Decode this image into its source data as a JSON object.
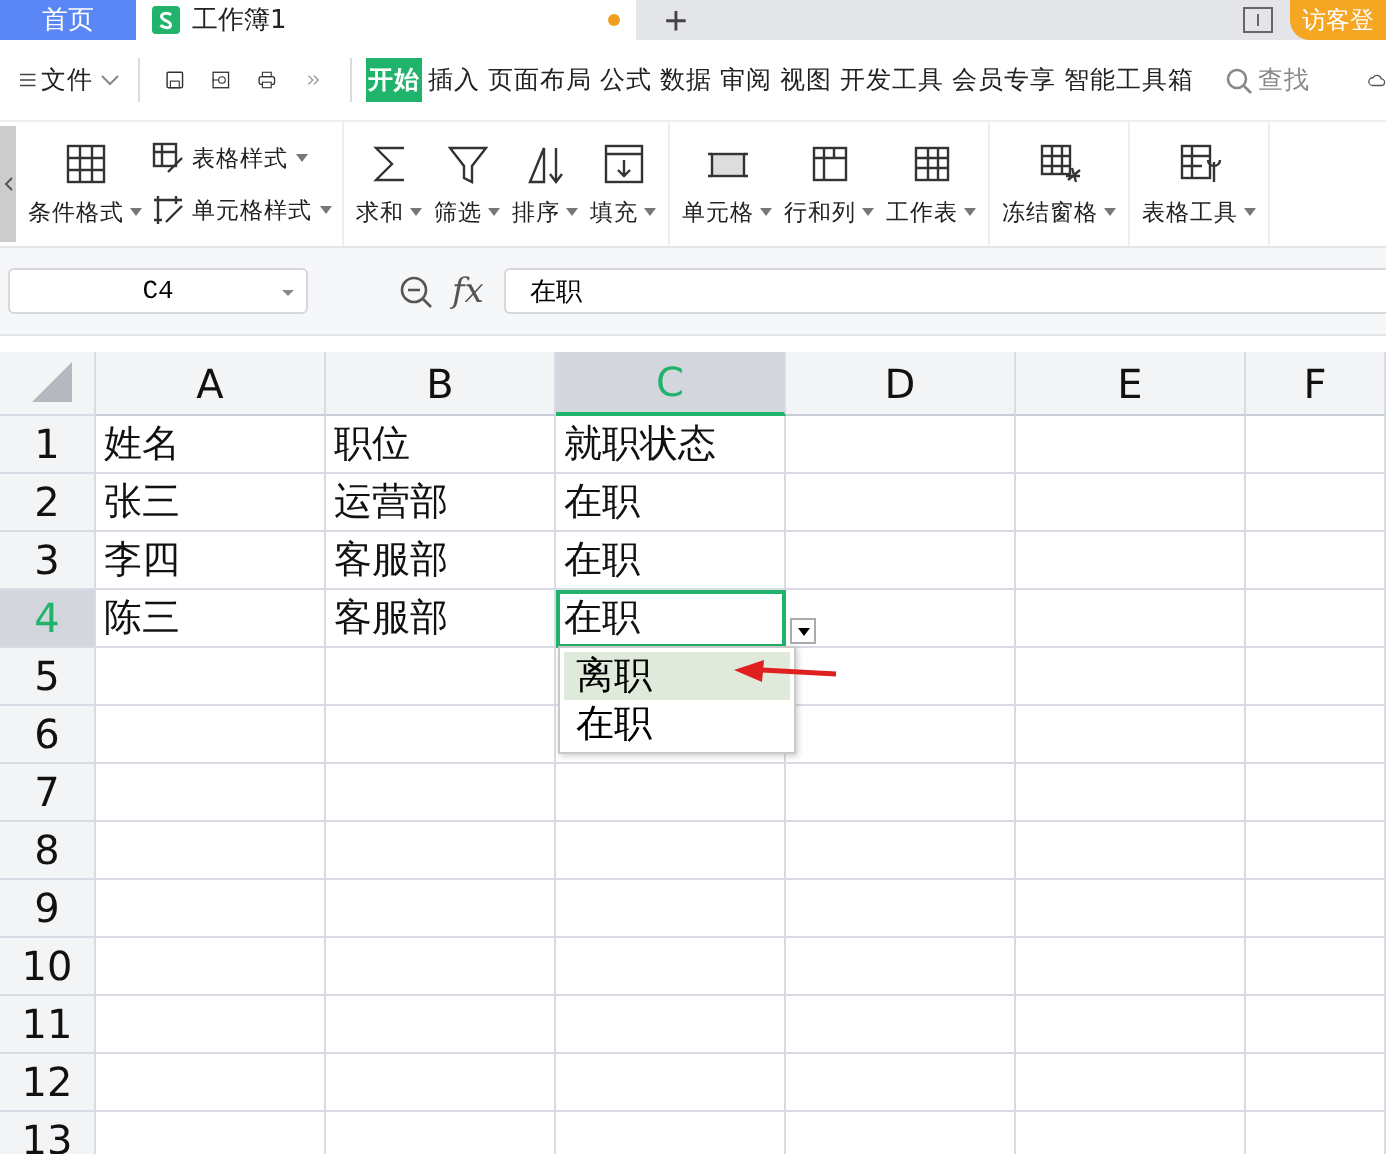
{
  "tabs": [
    {
      "label": "首页",
      "selected": false,
      "modified": false
    },
    {
      "label": "工作簿1",
      "selected": true,
      "modified": true
    }
  ],
  "new_tab": "+",
  "account_button": "访客登",
  "menu": {
    "file": "文件",
    "search": "查找",
    "items": [
      {
        "label": "开始",
        "selected": true
      },
      {
        "label": "插入",
        "selected": false
      },
      {
        "label": "页面布局",
        "selected": false
      },
      {
        "label": "公式",
        "selected": false
      },
      {
        "label": "数据",
        "selected": false
      },
      {
        "label": "审阅",
        "selected": false
      },
      {
        "label": "视图",
        "selected": false
      },
      {
        "label": "开发工具",
        "selected": false
      },
      {
        "label": "会员专享",
        "selected": false
      },
      {
        "label": "智能工具箱",
        "selected": false
      }
    ]
  },
  "ribbon": [
    [
      {
        "kind": "large",
        "label": "条件格式"
      },
      {
        "kind": "stack",
        "items": [
          "表格样式",
          "单元格样式"
        ]
      }
    ],
    [
      {
        "kind": "large",
        "label": "求和"
      },
      {
        "kind": "large",
        "label": "筛选"
      },
      {
        "kind": "large",
        "label": "排序"
      },
      {
        "kind": "large",
        "label": "填充"
      }
    ],
    [
      {
        "kind": "large",
        "label": "单元格"
      },
      {
        "kind": "large",
        "label": "行和列"
      },
      {
        "kind": "large",
        "label": "工作表"
      }
    ],
    [
      {
        "kind": "large",
        "label": "冻结窗格"
      }
    ],
    [
      {
        "kind": "large",
        "label": "表格工具"
      }
    ]
  ],
  "formula_bar": {
    "name_box": "C4",
    "fx": "fx",
    "value": "在职"
  },
  "sheet": {
    "columns": [
      {
        "label": "A",
        "selected": false
      },
      {
        "label": "B",
        "selected": false
      },
      {
        "label": "C",
        "selected": true
      },
      {
        "label": "D",
        "selected": false
      },
      {
        "label": "E",
        "selected": false
      },
      {
        "label": "F",
        "selected": false
      }
    ],
    "rows": [
      {
        "number": "1",
        "selected": false,
        "cells": [
          "姓名",
          "职位",
          "就职状态"
        ]
      },
      {
        "number": "2",
        "selected": false,
        "cells": [
          "张三",
          "运营部",
          "在职"
        ]
      },
      {
        "number": "3",
        "selected": false,
        "cells": [
          "李四",
          "客服部",
          "在职"
        ]
      },
      {
        "number": "4",
        "selected": true,
        "cells": [
          "陈三",
          "客服部",
          "在职"
        ]
      },
      {
        "number": "5",
        "selected": false,
        "cells": []
      },
      {
        "number": "6",
        "selected": false,
        "cells": []
      },
      {
        "number": "7",
        "selected": false,
        "cells": []
      },
      {
        "number": "8",
        "selected": false,
        "cells": []
      },
      {
        "number": "9",
        "selected": false,
        "cells": []
      },
      {
        "number": "10",
        "selected": false,
        "cells": []
      },
      {
        "number": "11",
        "selected": false,
        "cells": []
      },
      {
        "number": "12",
        "selected": false,
        "cells": []
      },
      {
        "number": "13",
        "selected": false,
        "cells": []
      }
    ],
    "dropdown": {
      "options": [
        {
          "label": "离职",
          "selected": true
        },
        {
          "label": "在职",
          "selected": false
        }
      ]
    }
  }
}
